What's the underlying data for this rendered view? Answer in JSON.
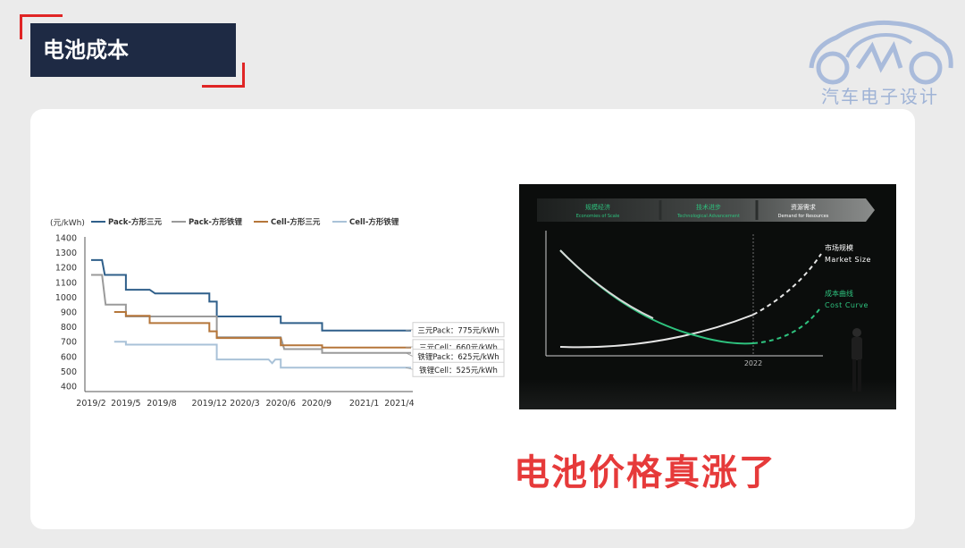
{
  "header": {
    "title": "电池成本"
  },
  "watermark": {
    "text": "汽车电子设计"
  },
  "chart_data": {
    "type": "line",
    "unit_label": "(元/kWh)",
    "x_ticks": [
      "2019/2",
      "2019/5",
      "2019/8",
      "2019/12",
      "2020/3",
      "2020/6",
      "2020/9",
      "2021/1",
      "2021/4"
    ],
    "x_range": [
      "2019-02",
      "2021-05"
    ],
    "y_ticks": [
      400,
      500,
      600,
      700,
      800,
      900,
      1000,
      1100,
      1200,
      1300,
      1400
    ],
    "ylim": [
      400,
      1400
    ],
    "grid": false,
    "legend_position": "top",
    "series": [
      {
        "name": "Pack-方形三元",
        "color": "#2f5f8a",
        "points": [
          [
            "2019-02-01",
            1250
          ],
          [
            "2019-03-01",
            1250
          ],
          [
            "2019-03-08",
            1150
          ],
          [
            "2019-05-01",
            1150
          ],
          [
            "2019-05-01",
            1050
          ],
          [
            "2019-07-01",
            1050
          ],
          [
            "2019-07-15",
            1025
          ],
          [
            "2019-12-01",
            1025
          ],
          [
            "2019-12-01",
            970
          ],
          [
            "2019-12-20",
            970
          ],
          [
            "2019-12-20",
            870
          ],
          [
            "2020-06-01",
            870
          ],
          [
            "2020-06-01",
            825
          ],
          [
            "2020-09-15",
            825
          ],
          [
            "2020-09-15",
            775
          ],
          [
            "2021-05-01",
            775
          ]
        ]
      },
      {
        "name": "Pack-方形铁锂",
        "color": "#9a9a9a",
        "points": [
          [
            "2019-02-01",
            1150
          ],
          [
            "2019-03-01",
            1150
          ],
          [
            "2019-03-10",
            950
          ],
          [
            "2019-05-01",
            950
          ],
          [
            "2019-05-01",
            870
          ],
          [
            "2019-12-20",
            870
          ],
          [
            "2019-12-20",
            730
          ],
          [
            "2020-06-01",
            730
          ],
          [
            "2020-06-10",
            650
          ],
          [
            "2020-09-15",
            650
          ],
          [
            "2020-09-15",
            625
          ],
          [
            "2021-05-01",
            625
          ]
        ]
      },
      {
        "name": "Cell-方形三元",
        "color": "#b5763a",
        "points": [
          [
            "2019-04-01",
            900
          ],
          [
            "2019-05-01",
            900
          ],
          [
            "2019-05-01",
            875
          ],
          [
            "2019-07-01",
            875
          ],
          [
            "2019-07-01",
            825
          ],
          [
            "2019-12-01",
            825
          ],
          [
            "2019-12-01",
            770
          ],
          [
            "2019-12-20",
            770
          ],
          [
            "2019-12-20",
            725
          ],
          [
            "2020-06-01",
            725
          ],
          [
            "2020-06-01",
            675
          ],
          [
            "2020-09-15",
            675
          ],
          [
            "2020-09-15",
            660
          ],
          [
            "2021-05-01",
            660
          ]
        ]
      },
      {
        "name": "Cell-方形铁锂",
        "color": "#a9c2d8",
        "points": [
          [
            "2019-04-01",
            700
          ],
          [
            "2019-05-01",
            700
          ],
          [
            "2019-05-01",
            680
          ],
          [
            "2019-12-20",
            680
          ],
          [
            "2019-12-20",
            580
          ],
          [
            "2020-05-01",
            580
          ],
          [
            "2020-05-10",
            555
          ],
          [
            "2020-05-18",
            580
          ],
          [
            "2020-06-01",
            580
          ],
          [
            "2020-06-01",
            525
          ],
          [
            "2021-05-01",
            525
          ]
        ]
      }
    ],
    "annotations": [
      {
        "text": "三元Pack：775元/kWh",
        "value": 775
      },
      {
        "text": "三元Cell：660元/kWh",
        "value": 660
      },
      {
        "text": "铁锂Pack：625元/kWh",
        "value": 625
      },
      {
        "text": "铁锂Cell：525元/kWh",
        "value": 525
      }
    ]
  },
  "photo": {
    "phases": [
      {
        "cn": "规模经济",
        "en": "Economies of Scale"
      },
      {
        "cn": "技术进步",
        "en": "Technological Advancement"
      },
      {
        "cn": "资源需求",
        "en": "Demand for Resources"
      }
    ],
    "curves": [
      {
        "cn": "市场规模",
        "en": "Market Size"
      },
      {
        "cn": "成本曲线",
        "en": "Cost Curve"
      }
    ],
    "year_label": "2022"
  },
  "caption": {
    "text": "电池价格真涨了"
  },
  "colors": {
    "accent_red": "#e02525",
    "title_bg": "#1e2a44",
    "caption_red": "#e63a3a",
    "cost_green": "#2ec27e"
  }
}
